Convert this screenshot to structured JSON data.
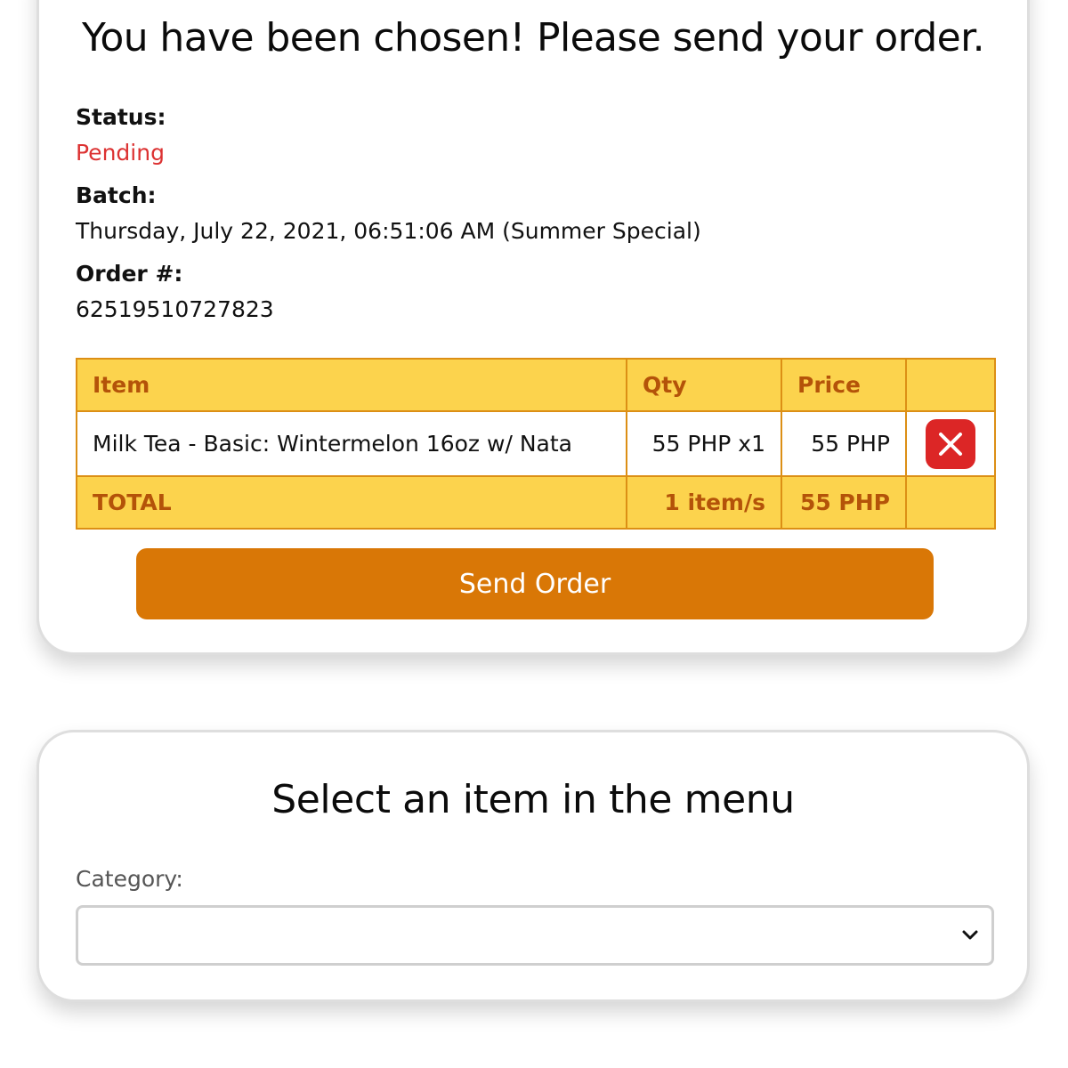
{
  "order_card": {
    "title": "You have been chosen! Please send your order.",
    "status_label": "Status:",
    "status_value": "Pending",
    "batch_label": "Batch:",
    "batch_value": "Thursday, July 22, 2021, 06:51:06 AM (Summer Special)",
    "order_label": "Order #:",
    "order_value": "62519510727823",
    "table": {
      "headers": {
        "item": "Item",
        "qty": "Qty",
        "price": "Price"
      },
      "rows": [
        {
          "item": "Milk Tea - Basic: Wintermelon 16oz w/ Nata",
          "qty": "55 PHP x1",
          "price": "55 PHP"
        }
      ],
      "total": {
        "label": "TOTAL",
        "qty": "1 item/s",
        "price": "55 PHP"
      }
    },
    "send_button": "Send Order"
  },
  "menu_card": {
    "title": "Select an item in the menu",
    "category_label": "Category:",
    "category_selected": ""
  },
  "icons": {
    "remove": "close-icon",
    "select": "chevron-down-icon"
  },
  "colors": {
    "status_pending": "#dc3232",
    "table_header_bg": "#fcd34d",
    "table_header_text": "#b45309",
    "table_border": "#dc8f15",
    "send_button_bg": "#d97706",
    "remove_button_bg": "#dc2626"
  }
}
